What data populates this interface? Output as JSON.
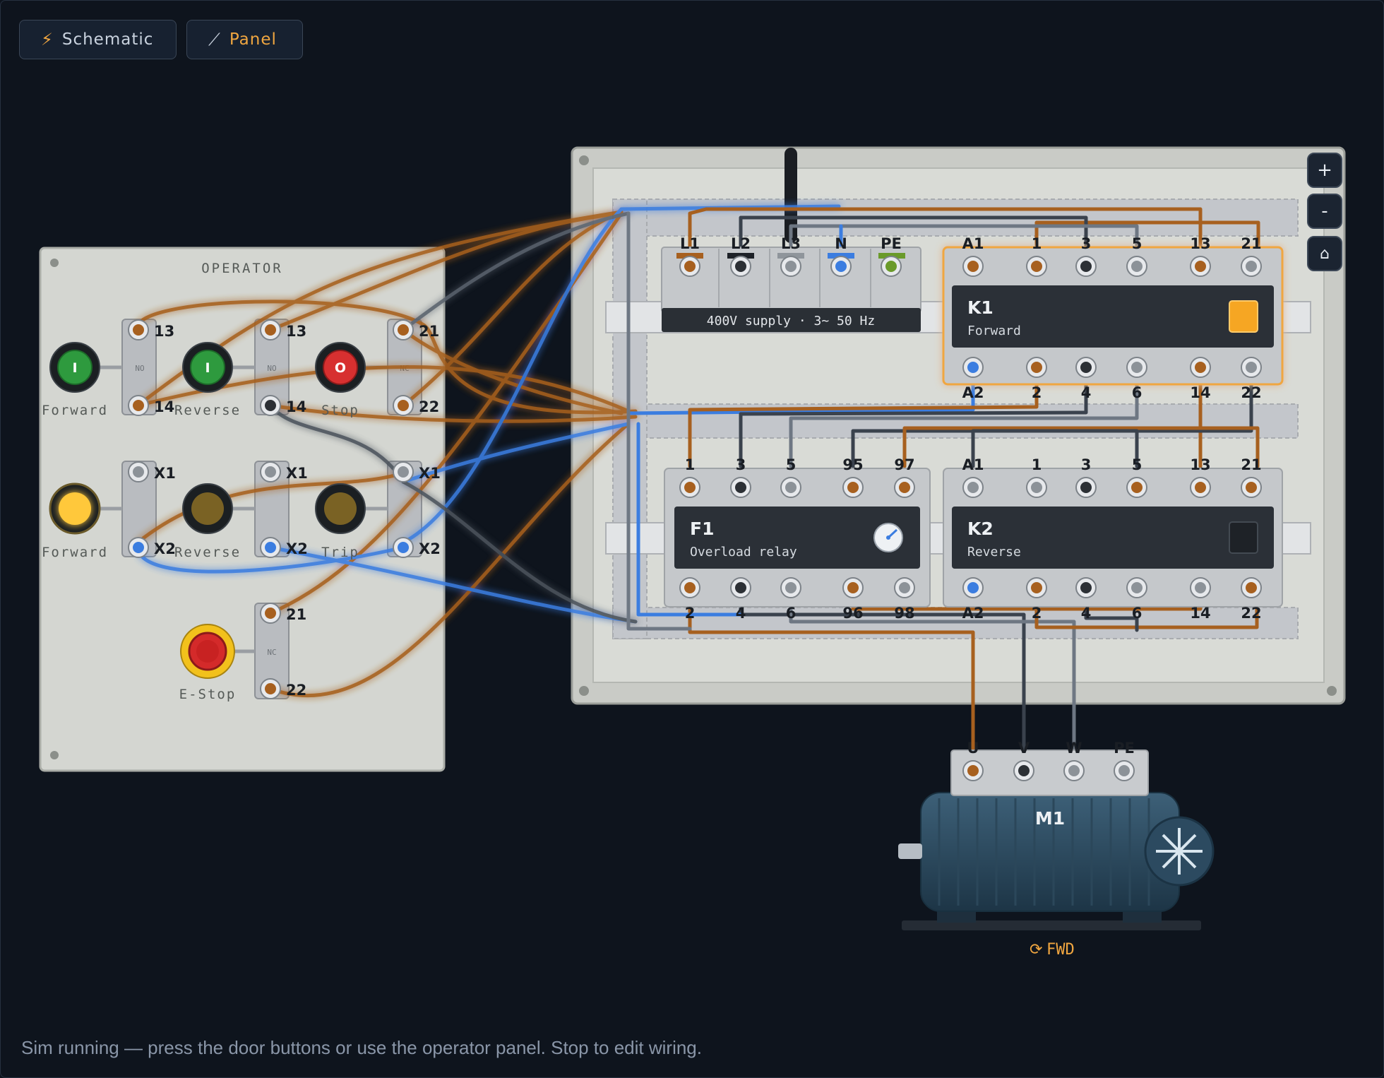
{
  "toolbar": {
    "schematic_label": "Schematic",
    "schematic_icon": "lightning-icon",
    "panel_label": "Panel",
    "panel_icon": "wrench-icon",
    "active_tab": "Panel"
  },
  "zoom": {
    "in_label": "+",
    "out_label": "-",
    "home_icon": "home-icon"
  },
  "colors": {
    "accent": "#f0a640",
    "brown_wire": "#a7601f",
    "blue_wire": "#3b7de0",
    "dark_wire": "#3a424d",
    "grey_wire": "#6e7783",
    "lamp_on": "#ffc83a",
    "pe_green": "#6a9a2a"
  },
  "operator": {
    "title": "OPERATOR",
    "forward_btn": {
      "symbol": "I",
      "label": "Forward",
      "contact_type": "NO",
      "t1": "13",
      "t2": "14"
    },
    "reverse_btn": {
      "symbol": "I",
      "label": "Reverse",
      "contact_type": "NO",
      "t1": "13",
      "t2": "14"
    },
    "stop_btn": {
      "symbol": "O",
      "label": "Stop",
      "contact_type": "NC",
      "t1": "21",
      "t2": "22"
    },
    "forward_lamp": {
      "label": "Forward",
      "t1": "X1",
      "t2": "X2",
      "state": "on"
    },
    "reverse_lamp": {
      "label": "Reverse",
      "t1": "X1",
      "t2": "X2",
      "state": "off"
    },
    "trip_lamp": {
      "label": "Trip",
      "t1": "X1",
      "t2": "X2",
      "state": "off"
    },
    "estop": {
      "label": "E-Stop",
      "contact_type": "NC",
      "t1": "21",
      "t2": "22"
    }
  },
  "supply": {
    "terminals": [
      "L1",
      "L2",
      "L3",
      "N",
      "PE"
    ],
    "label": "400V supply · 3~ 50 Hz"
  },
  "k1": {
    "name": "K1",
    "desc": "Forward",
    "top_terminals": [
      "A1",
      "1",
      "3",
      "5",
      "13",
      "21"
    ],
    "bottom_terminals": [
      "A2",
      "2",
      "4",
      "6",
      "14",
      "22"
    ],
    "state": "energized"
  },
  "k2": {
    "name": "K2",
    "desc": "Reverse",
    "top_terminals": [
      "A1",
      "1",
      "3",
      "5",
      "13",
      "21"
    ],
    "bottom_terminals": [
      "A2",
      "2",
      "4",
      "6",
      "14",
      "22"
    ],
    "state": "off"
  },
  "f1": {
    "name": "F1",
    "desc": "Overload relay",
    "top_terminals": [
      "1",
      "3",
      "5",
      "95",
      "97"
    ],
    "bottom_terminals": [
      "2",
      "4",
      "6",
      "96",
      "98"
    ]
  },
  "motor": {
    "name": "M1",
    "terminals": [
      "U",
      "V",
      "W",
      "PE"
    ],
    "direction_icon": "rotate-icon",
    "direction_label": "FWD"
  },
  "status_text": "Sim running — press the door buttons or use the operator panel. Stop to edit wiring."
}
